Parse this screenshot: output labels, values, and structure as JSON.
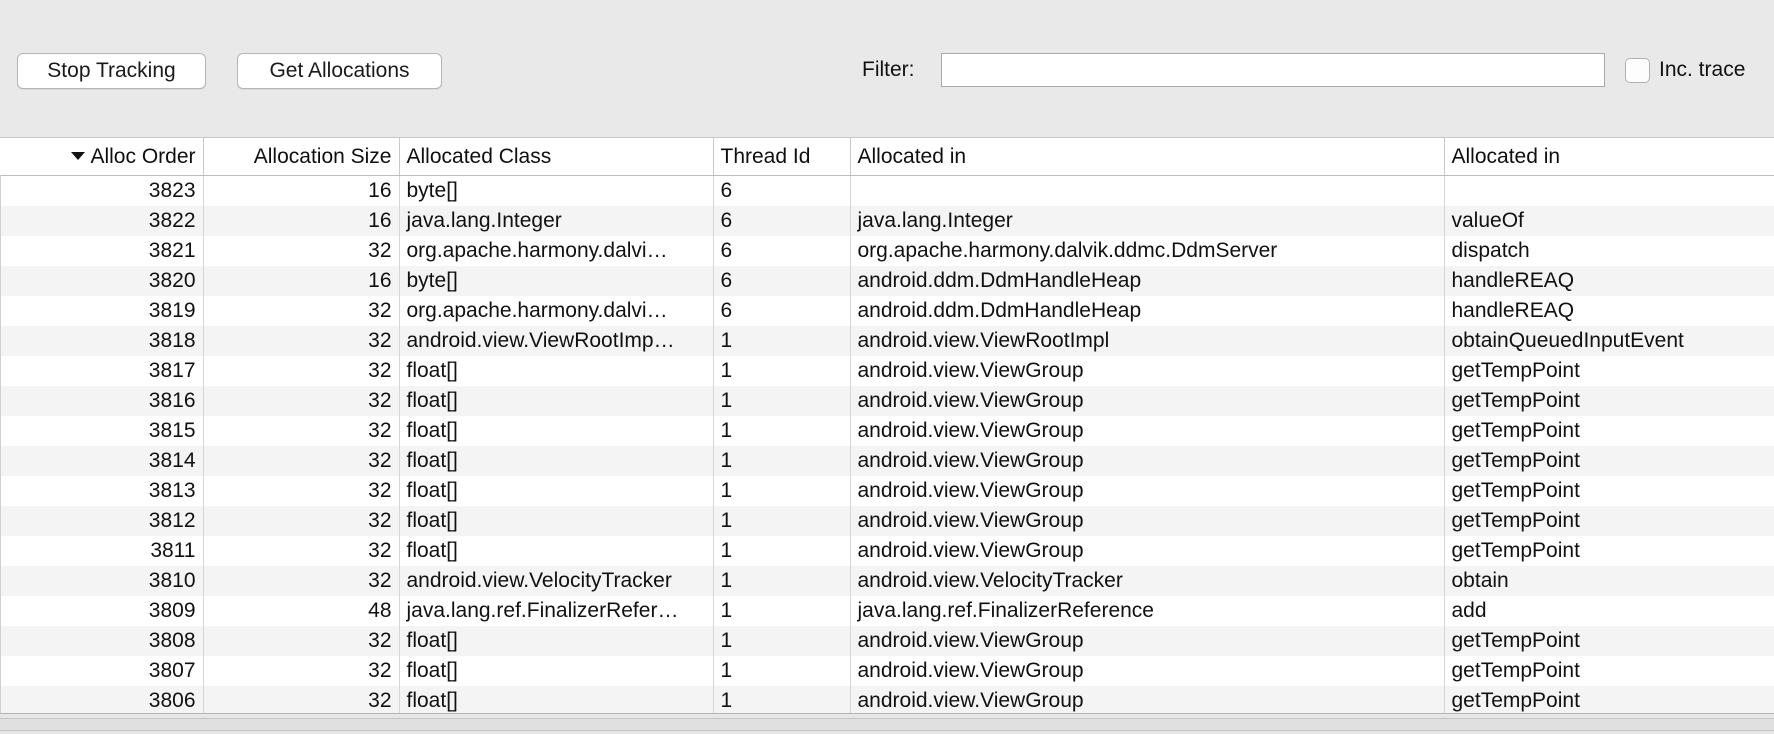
{
  "toolbar": {
    "stop_tracking_label": "Stop Tracking",
    "get_allocations_label": "Get Allocations",
    "filter_label": "Filter:",
    "filter_value": "",
    "filter_placeholder": "",
    "inc_trace_label": "Inc. trace",
    "inc_trace_checked": false
  },
  "table": {
    "sort_column": "Alloc Order",
    "sort_direction": "descending",
    "sort_caret": "▼",
    "columns": [
      {
        "label": "Alloc Order",
        "align": "right"
      },
      {
        "label": "Allocation Size",
        "align": "right"
      },
      {
        "label": "Allocated Class",
        "align": "left"
      },
      {
        "label": "Thread Id",
        "align": "left"
      },
      {
        "label": "Allocated in",
        "align": "left"
      },
      {
        "label": "Allocated in",
        "align": "left"
      }
    ],
    "rows": [
      [
        "3823",
        "16",
        "byte[]",
        "6",
        "",
        ""
      ],
      [
        "3822",
        "16",
        "java.lang.Integer",
        "6",
        "java.lang.Integer",
        "valueOf"
      ],
      [
        "3821",
        "32",
        "org.apache.harmony.dalvi…",
        "6",
        "org.apache.harmony.dalvik.ddmc.DdmServer",
        "dispatch"
      ],
      [
        "3820",
        "16",
        "byte[]",
        "6",
        "android.ddm.DdmHandleHeap",
        "handleREAQ"
      ],
      [
        "3819",
        "32",
        "org.apache.harmony.dalvi…",
        "6",
        "android.ddm.DdmHandleHeap",
        "handleREAQ"
      ],
      [
        "3818",
        "32",
        "android.view.ViewRootImp…",
        "1",
        "android.view.ViewRootImpl",
        "obtainQueuedInputEvent"
      ],
      [
        "3817",
        "32",
        "float[]",
        "1",
        "android.view.ViewGroup",
        "getTempPoint"
      ],
      [
        "3816",
        "32",
        "float[]",
        "1",
        "android.view.ViewGroup",
        "getTempPoint"
      ],
      [
        "3815",
        "32",
        "float[]",
        "1",
        "android.view.ViewGroup",
        "getTempPoint"
      ],
      [
        "3814",
        "32",
        "float[]",
        "1",
        "android.view.ViewGroup",
        "getTempPoint"
      ],
      [
        "3813",
        "32",
        "float[]",
        "1",
        "android.view.ViewGroup",
        "getTempPoint"
      ],
      [
        "3812",
        "32",
        "float[]",
        "1",
        "android.view.ViewGroup",
        "getTempPoint"
      ],
      [
        "3811",
        "32",
        "float[]",
        "1",
        "android.view.ViewGroup",
        "getTempPoint"
      ],
      [
        "3810",
        "32",
        "android.view.VelocityTracker",
        "1",
        "android.view.VelocityTracker",
        "obtain"
      ],
      [
        "3809",
        "48",
        "java.lang.ref.FinalizerRefer…",
        "1",
        "java.lang.ref.FinalizerReference",
        "add"
      ],
      [
        "3808",
        "32",
        "float[]",
        "1",
        "android.view.ViewGroup",
        "getTempPoint"
      ],
      [
        "3807",
        "32",
        "float[]",
        "1",
        "android.view.ViewGroup",
        "getTempPoint"
      ],
      [
        "3806",
        "32",
        "float[]",
        "1",
        "android.view.ViewGroup",
        "getTempPoint"
      ]
    ]
  },
  "colors": {
    "toolbar_bg": "#e9e9e9",
    "row_bg": "#ffffff",
    "row_alt_bg": "#f4f4f4",
    "text": "#111111",
    "grid_line": "#d6d6d6"
  }
}
